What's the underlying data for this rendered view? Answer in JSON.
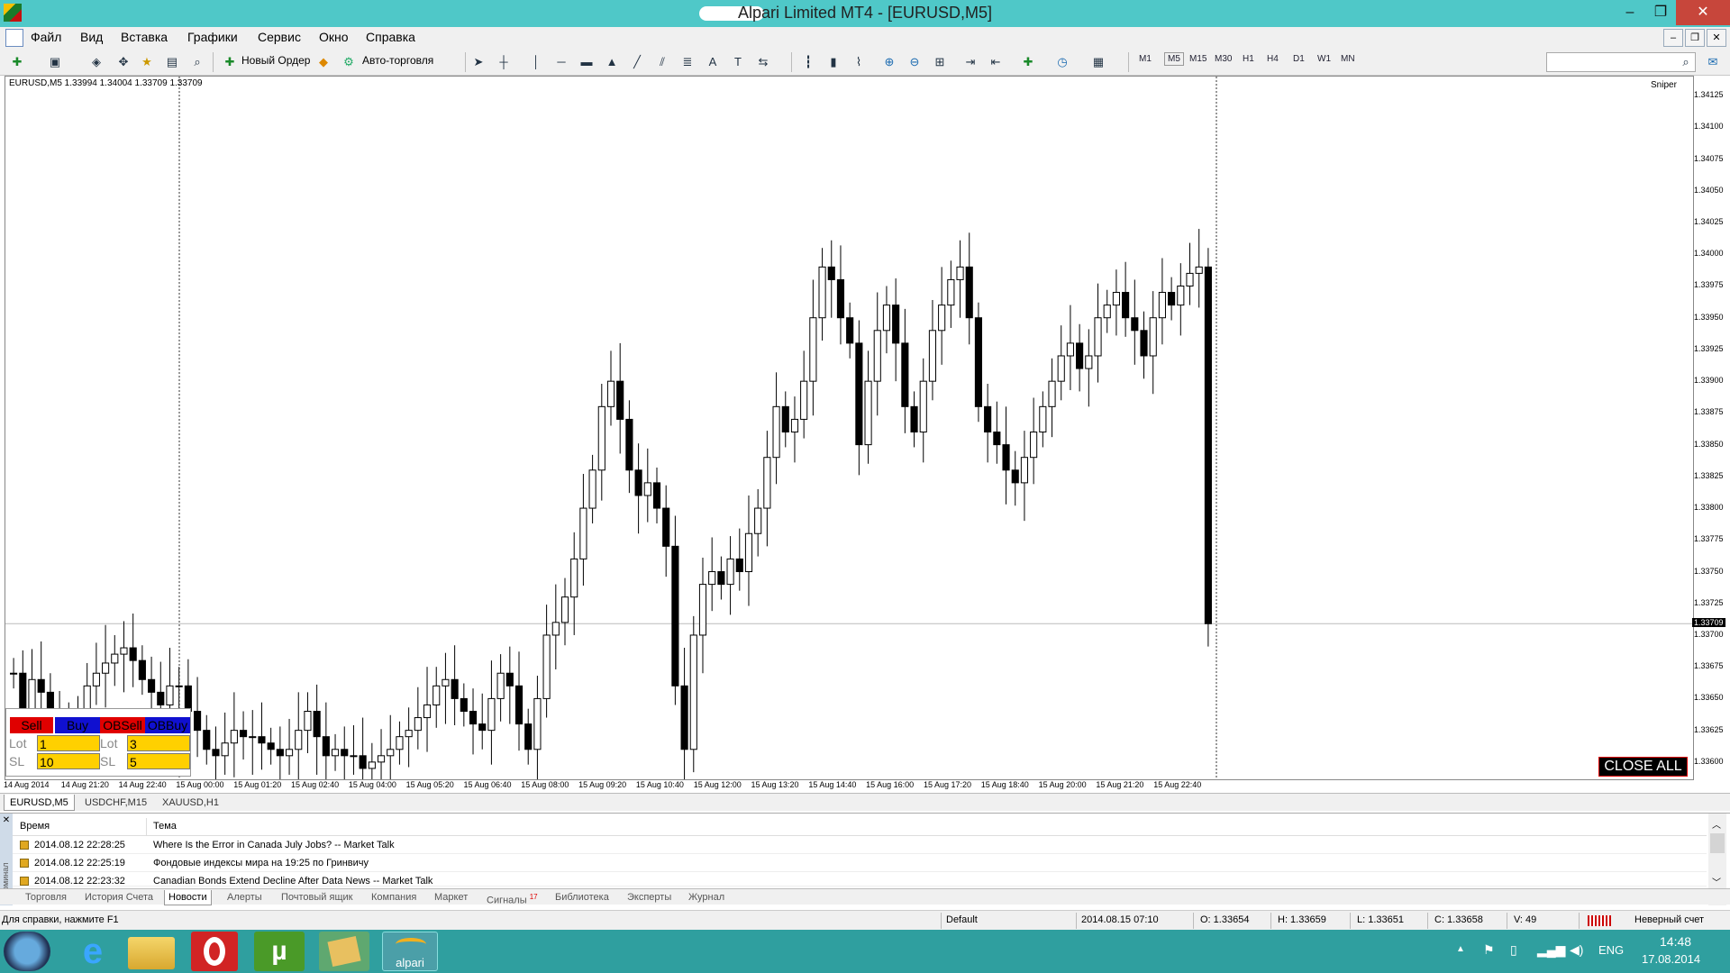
{
  "window": {
    "title": "Alpari Limited MT4 - [EURUSD,M5]",
    "controls": [
      "–",
      "❐",
      "✕"
    ]
  },
  "menu": {
    "items": [
      "Файл",
      "Вид",
      "Вставка",
      "Графики",
      "Сервис",
      "Окно",
      "Справка"
    ],
    "mdi_controls": [
      "–",
      "❐",
      "✕"
    ]
  },
  "toolbar": {
    "new_order": "Новый Ордер",
    "auto_trading": "Авто-торговля",
    "timeframes": [
      "M1",
      "M5",
      "M15",
      "M30",
      "H1",
      "H4",
      "D1",
      "W1",
      "MN"
    ],
    "active_timeframe": "M5"
  },
  "chart": {
    "info": "EURUSD,M5  1.33994 1.34004 1.33709 1.33709",
    "indicator_label": "Sniper",
    "current_price": "1.33709",
    "price_axis": [
      "1.34125",
      "1.34100",
      "1.34075",
      "1.34050",
      "1.34025",
      "1.34000",
      "1.33975",
      "1.33950",
      "1.33925",
      "1.33900",
      "1.33875",
      "1.33850",
      "1.33825",
      "1.33800",
      "1.33775",
      "1.33750",
      "1.33725",
      "1.33700",
      "1.33675",
      "1.33650",
      "1.33625",
      "1.33600"
    ],
    "time_axis": [
      "14 Aug 2014",
      "14 Aug 21:20",
      "14 Aug 22:40",
      "15 Aug 00:00",
      "15 Aug 01:20",
      "15 Aug 02:40",
      "15 Aug 04:00",
      "15 Aug 05:20",
      "15 Aug 06:40",
      "15 Aug 08:00",
      "15 Aug 09:20",
      "15 Aug 10:40",
      "15 Aug 12:00",
      "15 Aug 13:20",
      "15 Aug 14:40",
      "15 Aug 16:00",
      "15 Aug 17:20",
      "15 Aug 18:40",
      "15 Aug 20:00",
      "15 Aug 21:20",
      "15 Aug 22:40"
    ],
    "close_all": "CLOSE ALL"
  },
  "trade_panel": {
    "sell": "Sell",
    "buy": "Buy",
    "obsell": "OBSell",
    "obbuy": "OBBuy",
    "lot_label": "Lot",
    "sl_label": "SL",
    "lot_left": "1",
    "sl_left": "10",
    "lot_right": "3",
    "sl_right": "5"
  },
  "chart_tabs": [
    "EURUSD,M5",
    "USDCHF,M15",
    "XAUUSD,H1"
  ],
  "terminal": {
    "side_label": "Терминал",
    "col_time": "Время",
    "col_subject": "Тема",
    "rows": [
      {
        "time": "2014.08.12 22:28:25",
        "subject": "Where Is the Error in Canada July Jobs? -- Market Talk"
      },
      {
        "time": "2014.08.12 22:25:19",
        "subject": "Фондовые индексы мира на 19:25 по Гринвичу"
      },
      {
        "time": "2014.08.12 22:23:32",
        "subject": "Canadian Bonds Extend Decline After Data News -- Market Talk"
      }
    ],
    "tabs": [
      "Торговля",
      "История Счета",
      "Новости",
      "Алерты",
      "Почтовый ящик",
      "Компания",
      "Маркет",
      "Сигналы",
      "Библиотека",
      "Эксперты",
      "Журнал"
    ],
    "signals_badge": "17",
    "active_tab": "Новости"
  },
  "status": {
    "help": "Для справки, нажмите F1",
    "profile": "Default",
    "datetime": "2014.08.15 07:10",
    "open": "O: 1.33654",
    "high": "H: 1.33659",
    "low": "L: 1.33651",
    "close": "C: 1.33658",
    "volume": "V: 49",
    "account": "Неверный счет"
  },
  "taskbar": {
    "apps": [
      "start-orb",
      "internet-explorer",
      "file-explorer",
      "opera",
      "utorrent",
      "book-app",
      "alpari"
    ],
    "alpari_label": "alpari",
    "lang": "ENG",
    "time": "14:48",
    "date": "17.08.2014"
  },
  "chart_data": {
    "type": "candlestick",
    "symbol": "EURUSD",
    "timeframe": "M5",
    "ylim": [
      1.33585,
      1.3414
    ],
    "last_price": 1.33709,
    "closes": [
      1.3367,
      1.3364,
      1.33665,
      1.33655,
      1.33635,
      1.3362,
      1.33615,
      1.3364,
      1.3366,
      1.3367,
      1.33678,
      1.33685,
      1.3369,
      1.3368,
      1.33665,
      1.33655,
      1.33645,
      1.3366,
      1.3366,
      1.3364,
      1.33625,
      1.3361,
      1.33605,
      1.33615,
      1.33625,
      1.3362,
      1.3362,
      1.33615,
      1.3361,
      1.33605,
      1.3361,
      1.33625,
      1.3364,
      1.3362,
      1.33605,
      1.3361,
      1.33605,
      1.33605,
      1.33595,
      1.336,
      1.33605,
      1.3361,
      1.3362,
      1.33625,
      1.33635,
      1.33645,
      1.3366,
      1.33665,
      1.3365,
      1.3364,
      1.3363,
      1.33625,
      1.3365,
      1.3367,
      1.3366,
      1.3363,
      1.3361,
      1.3365,
      1.337,
      1.3371,
      1.3373,
      1.3376,
      1.338,
      1.3383,
      1.3388,
      1.339,
      1.3387,
      1.3383,
      1.3381,
      1.3382,
      1.338,
      1.3377,
      1.3366,
      1.3361,
      1.337,
      1.3374,
      1.3375,
      1.3374,
      1.3376,
      1.3375,
      1.3378,
      1.338,
      1.3384,
      1.3388,
      1.3386,
      1.3387,
      1.339,
      1.3395,
      1.3399,
      1.3398,
      1.3395,
      1.3393,
      1.3385,
      1.339,
      1.3394,
      1.3396,
      1.3393,
      1.3388,
      1.3386,
      1.339,
      1.3394,
      1.3396,
      1.3398,
      1.3399,
      1.3395,
      1.3388,
      1.3386,
      1.3385,
      1.3383,
      1.3382,
      1.3384,
      1.3386,
      1.3388,
      1.339,
      1.3392,
      1.3393,
      1.3391,
      1.3392,
      1.3395,
      1.3396,
      1.3397,
      1.3395,
      1.3394,
      1.3392,
      1.3395,
      1.3397,
      1.3396,
      1.33975,
      1.33985,
      1.3399,
      1.33709
    ]
  }
}
